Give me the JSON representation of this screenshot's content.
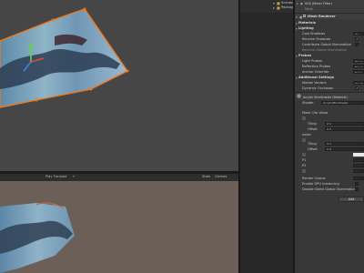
{
  "hierarchy": {
    "items": [
      "Scenes",
      "Packages"
    ]
  },
  "game_toolbar": {
    "play_mode": "Play Focused",
    "stats_label": "Stats",
    "gizmos_label": "Gizmos"
  },
  "inspector": {
    "header": {
      "material": "M-B (Mesh Filter)",
      "mesh_label": "Mesh",
      "component": "Mesh Renderer"
    },
    "materials_label": "Materials",
    "lighting": {
      "title": "Lighting",
      "cast_shadows": "Cast Shadows",
      "cast_shadows_value": "On",
      "receive_shadows": "Receive Shadows",
      "contribute_gi": "Contribute Global Illumination",
      "receive_gi": "Receive Global Illumination"
    },
    "probes": {
      "title": "Probes",
      "light_probes": "Light Probes",
      "light_probes_value": "Blend",
      "reflection_probes": "Reflection Probes",
      "reflection_probes_value": "Blend",
      "anchor_override": "Anchor Override",
      "anchor_override_value": "None"
    },
    "additional": {
      "title": "Additional Settings",
      "motion_vectors": "Motion Vectors",
      "motion_vectors_value": "Per Object",
      "dynamic_occlusion": "Dynamic Occlusion"
    },
    "shader_block": {
      "material_title": "Acrylic BlurShader (Material)",
      "shader_label": "Shader",
      "shader_value": "Acrylic/BlurShader"
    },
    "properties": {
      "mask_label": "Mask Clip Value",
      "tiling_label": "Tiling",
      "offset_label": "Offset",
      "tiling_x": "X 1",
      "offset_x": "X 0",
      "noise_label": "noise",
      "tiling2_label": "Tiling",
      "offset2_label": "Offset",
      "tiling2_x": "X 1",
      "offset2_x": "X 0",
      "p1": "P1",
      "p2": "P2"
    },
    "footer": {
      "render_queue": "Render Queue",
      "gpu_instancing": "Enable GPU Instancing",
      "double_sided_gi": "Double Sided Global Illumination",
      "add_button": "Add"
    }
  },
  "colors": {
    "selection_outline": "#f0781e",
    "inspector_bg": "#383838",
    "scene_bg": "#464646",
    "game_bg": "#6b5f58"
  }
}
